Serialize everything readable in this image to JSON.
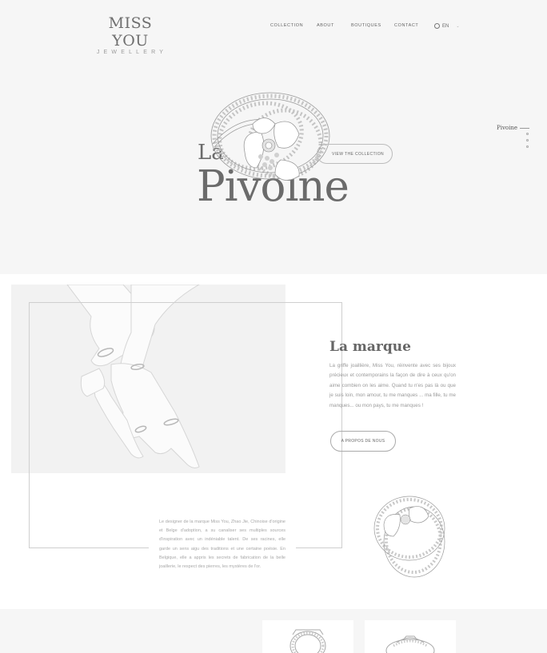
{
  "logo": {
    "main": "MISS YOU",
    "sub": "JEWELLERY"
  },
  "nav": {
    "items": [
      {
        "label": "COLLECTION"
      },
      {
        "label": "ABOUT"
      },
      {
        "label": "BOUTIQUES"
      },
      {
        "label": "CONTACT"
      }
    ],
    "language": "EN"
  },
  "hero": {
    "title_small": "La",
    "title_large": "Pivoine",
    "cta": "VIEW THE COLLECTION",
    "slider_label": "Pivoine"
  },
  "brand": {
    "title": "La marque",
    "text": "La griffe joaillière, Miss You, réinvente avec ses bijoux précieux et contemporains la façon de dire à ceux qu'on aime combien on les aime. Quand tu n'es pas là ou que je suis loin, mon amour, tu me manques ... ma fille, tu me manques... ou mon pays, tu me manques !",
    "cta": "A PROPOS DE NOUS",
    "designer_text": "Le designer de la marque Miss You, Zhao Jie, Chinoise d'origine et Belge d'adoption, a su canaliser ses multiples sources d'inspiration avec un indéniable talent. De ses racines, elle garde un sens aigu des traditions et une certaine poésie. En Belgique, elle a appris les secrets de fabrication de la belle joaillerie, le respect des pierres, les mystères de l'or."
  },
  "icons": [
    "globe-icon",
    "chevron-down-icon",
    "arrow-left-icon"
  ]
}
